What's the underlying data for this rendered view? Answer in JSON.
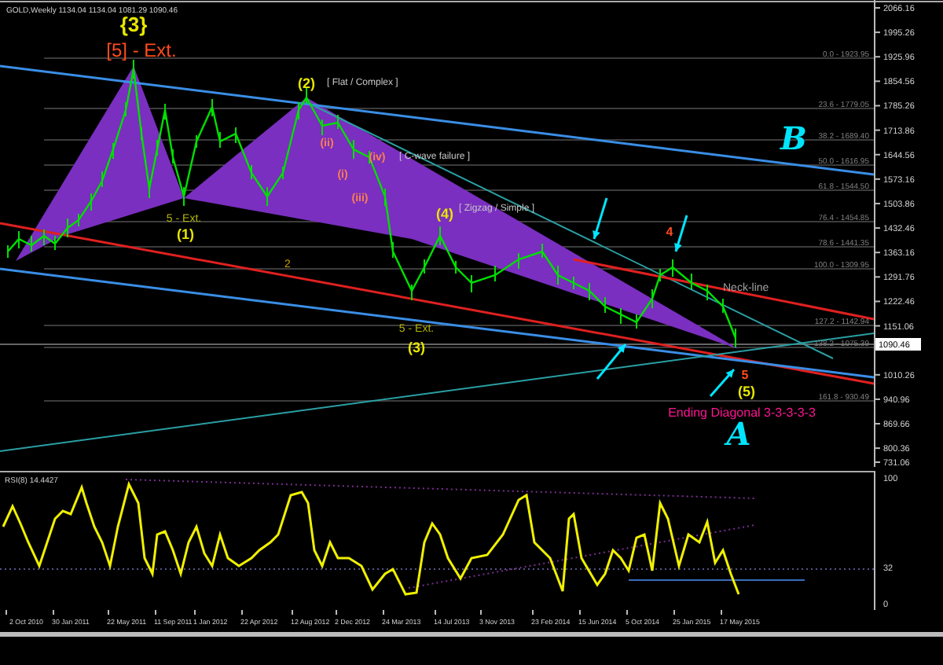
{
  "chart_header": {
    "symbol_info": "GOLD,Weekly  1134.04 1134.04 1081.29 1090.46"
  },
  "price_axis": {
    "labels": [
      "2066.16",
      "1995.26",
      "1925.96",
      "1854.56",
      "1785.26",
      "1713.86",
      "1644.56",
      "1573.16",
      "1503.86",
      "1432.46",
      "1363.16",
      "1291.76",
      "1222.46",
      "1151.06",
      "1010.26",
      "940.96",
      "869.66",
      "800.36",
      "731.06"
    ],
    "current_price": "1090.46"
  },
  "fib_levels": [
    {
      "label": "0.0 - 1923.95"
    },
    {
      "label": "23.6 - 1779.05"
    },
    {
      "label": "38.2 - 1689.40"
    },
    {
      "label": "50.0 - 1616.95"
    },
    {
      "label": "61.8 - 1544.50"
    },
    {
      "label": "76.4 - 1454.85"
    },
    {
      "label": "78.6 - 1441.35"
    },
    {
      "label": "100.0 - 1309.95"
    },
    {
      "label": "127.2 - 1142.94"
    },
    {
      "label": "138.2 - 1075.39"
    },
    {
      "label": "161.8 - 930.49"
    }
  ],
  "wave_labels": [
    {
      "text": "{3}",
      "color": "#e6e600"
    },
    {
      "text": "[5] - Ext.",
      "color": "#ff4a1c"
    },
    {
      "text": "(2)",
      "color": "#e6e600"
    },
    {
      "text": "[ Flat / Complex ]",
      "color": "#c8c8c8"
    },
    {
      "text": "5 - Ext.",
      "color": "#b4b400"
    },
    {
      "text": "(1)",
      "color": "#e6e600"
    },
    {
      "text": "[ C-wave failure ]",
      "color": "#c8c8c8"
    },
    {
      "text": "(4)",
      "color": "#e6e600"
    },
    {
      "text": "[ Zigzag / Simple ]",
      "color": "#c8c8c8"
    },
    {
      "text": "5 - Ext.",
      "color": "#b4b400"
    },
    {
      "text": "(3)",
      "color": "#e6e600"
    },
    {
      "text": "Neck-line",
      "color": "#a0a0a0"
    },
    {
      "text": "(5)",
      "color": "#e6e600"
    },
    {
      "text": "Ending Diagonal 3-3-3-3-3",
      "color": "#ff1493"
    },
    {
      "text": "2",
      "color": "#c8a000"
    },
    {
      "text": "(i)",
      "color": "#ff7f50"
    },
    {
      "text": "(ii)",
      "color": "#ff7f50"
    },
    {
      "text": "(iii)",
      "color": "#ff7f50"
    },
    {
      "text": "(iv)",
      "color": "#ff7f50"
    },
    {
      "text": "4",
      "color": "#ff4a1c"
    },
    {
      "text": "5",
      "color": "#ff4a1c"
    }
  ],
  "corrections": [
    {
      "text": "B"
    },
    {
      "text": "A"
    }
  ],
  "rsi_panel": {
    "label": "RSI(8) 14.4427",
    "axis_labels": [
      "100",
      "32",
      "0"
    ]
  },
  "time_axis": {
    "labels": [
      "2 Oct 2010",
      "30 Jan 2011",
      "22 May 2011",
      "11 Sep 2011",
      "1 Jan 2012",
      "22 Apr 2012",
      "12 Aug 2012",
      "2 Dec 2012",
      "24 Mar 2013",
      "14 Jul 2013",
      "3 Nov 2013",
      "23 Feb 2014",
      "15 Jun 2014",
      "5 Oct 2014",
      "25 Jan 2015",
      "17 May 2015"
    ]
  }
}
